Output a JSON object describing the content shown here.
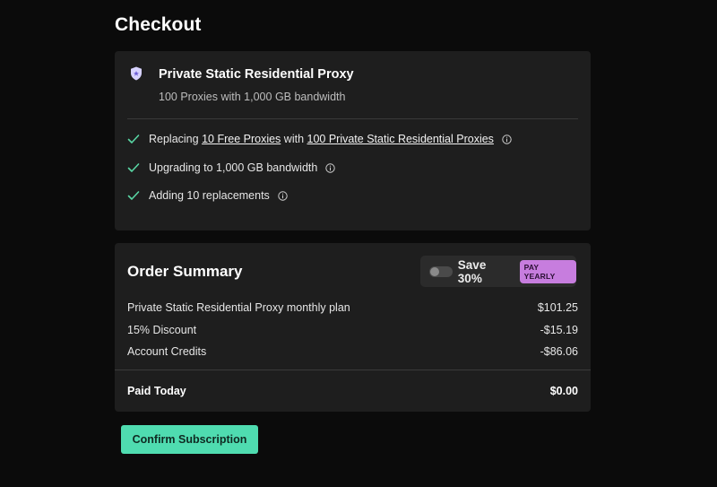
{
  "page": {
    "title": "Checkout"
  },
  "product": {
    "name": "Private Static Residential Proxy",
    "subtitle": "100 Proxies with 1,000 GB bandwidth",
    "icon": "shield-icon",
    "features": [
      {
        "prefix": "Replacing ",
        "link1": "10 Free Proxies",
        "middle": " with ",
        "link2": "100 Private Static Residential Proxies"
      },
      {
        "text": "Upgrading to 1,000 GB bandwidth"
      },
      {
        "text": "Adding 10 replacements"
      }
    ]
  },
  "summary": {
    "title": "Order Summary",
    "yearly_toggle": {
      "on": false,
      "save_label": "Save 30%",
      "badge": "PAY YEARLY"
    },
    "lines": [
      {
        "label": "Private Static Residential Proxy monthly plan",
        "amount": "$101.25"
      },
      {
        "label": "15% Discount",
        "amount": "-$15.19"
      },
      {
        "label": "Account Credits",
        "amount": "-$86.06"
      }
    ],
    "total": {
      "label": "Paid Today",
      "amount": "$0.00"
    }
  },
  "actions": {
    "confirm_label": "Confirm Subscription"
  },
  "colors": {
    "accent": "#4fdcb0",
    "badge": "#c77dde",
    "check": "#59d6a4",
    "card_bg": "#1e1e1e",
    "page_bg": "#0b0b0b"
  }
}
